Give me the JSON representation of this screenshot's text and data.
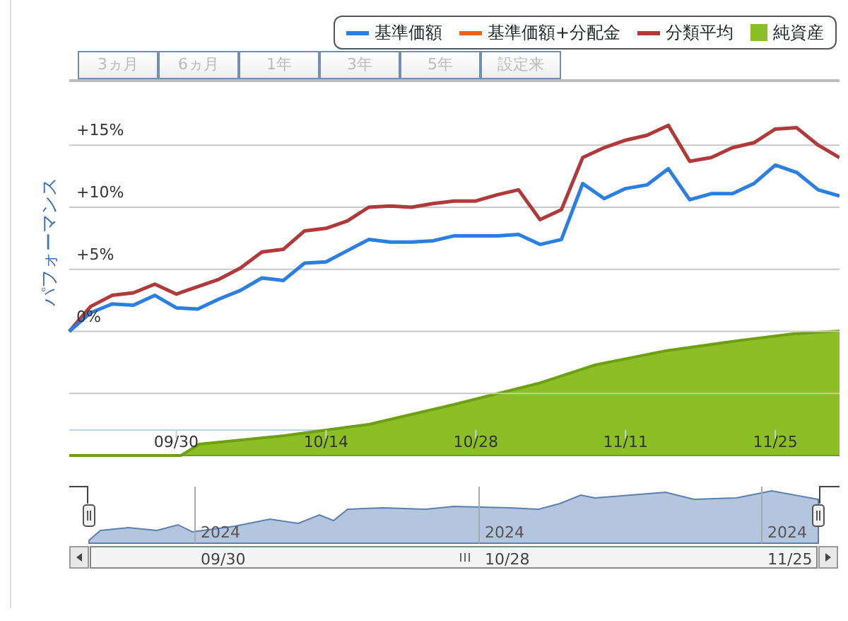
{
  "legend": [
    {
      "label": "基準価額",
      "color": "#2a7fe0",
      "kind": "line"
    },
    {
      "label": "基準価額+分配金",
      "color": "#f2601a",
      "kind": "line"
    },
    {
      "label": "分類平均",
      "color": "#b03a3a",
      "kind": "line"
    },
    {
      "label": "純資産",
      "color": "#8cbf26",
      "kind": "swatch"
    }
  ],
  "range_buttons": [
    {
      "label": "3ヵ月",
      "disabled": true
    },
    {
      "label": "6ヵ月",
      "disabled": true
    },
    {
      "label": "1年",
      "disabled": true
    },
    {
      "label": "3年",
      "disabled": true
    },
    {
      "label": "5年",
      "disabled": true
    },
    {
      "label": "設定来",
      "disabled": true
    }
  ],
  "chart": {
    "chart_data": {
      "type": "line",
      "ylabel": "パフォーマンス",
      "categories": [
        null,
        null,
        null,
        null,
        null,
        "09/30",
        null,
        null,
        null,
        null,
        null,
        null,
        "10/14",
        null,
        null,
        null,
        null,
        null,
        null,
        "10/28",
        null,
        null,
        null,
        null,
        null,
        null,
        "11/11",
        null,
        null,
        null,
        null,
        null,
        null,
        "11/25",
        null,
        null,
        null
      ],
      "series": [
        {
          "color": "#2a7fe0",
          "values": [
            0,
            1.5,
            2.2,
            2.1,
            2.9,
            1.9,
            1.8,
            2.6,
            3.3,
            4.3,
            4.1,
            5.5,
            5.6,
            6.5,
            7.4,
            7.2,
            7.2,
            7.3,
            7.7,
            7.7,
            7.7,
            7.8,
            7.0,
            7.4,
            11.9,
            10.7,
            11.5,
            11.8,
            13.1,
            10.6,
            11.1,
            11.1,
            11.9,
            13.4,
            12.8,
            11.4,
            10.9
          ]
        },
        {
          "color": "#b03a3a",
          "values": [
            0,
            2.0,
            2.9,
            3.1,
            3.8,
            3.0,
            3.6,
            4.2,
            5.1,
            6.4,
            6.6,
            8.1,
            8.3,
            8.9,
            10.0,
            10.1,
            10.0,
            10.3,
            10.5,
            10.5,
            11.0,
            11.4,
            9.0,
            9.8,
            14.0,
            14.8,
            15.4,
            15.8,
            16.6,
            13.7,
            14.0,
            14.8,
            15.2,
            16.3,
            16.4,
            15.0,
            14.0
          ]
        }
      ],
      "grid": true,
      "ylim": [
        -10,
        20.2
      ],
      "yticks": [
        {
          "value": 0,
          "label": "0%"
        },
        {
          "value": 5,
          "label": "+5%"
        },
        {
          "value": 10,
          "label": "+10%"
        },
        {
          "value": 15,
          "label": "+15%"
        }
      ]
    }
  },
  "navigator": {
    "ticks": [
      {
        "year": "2024",
        "date": "09/30"
      },
      {
        "year": "2024",
        "date": "10/28"
      },
      {
        "year": "2024",
        "date": "11/25"
      }
    ]
  }
}
